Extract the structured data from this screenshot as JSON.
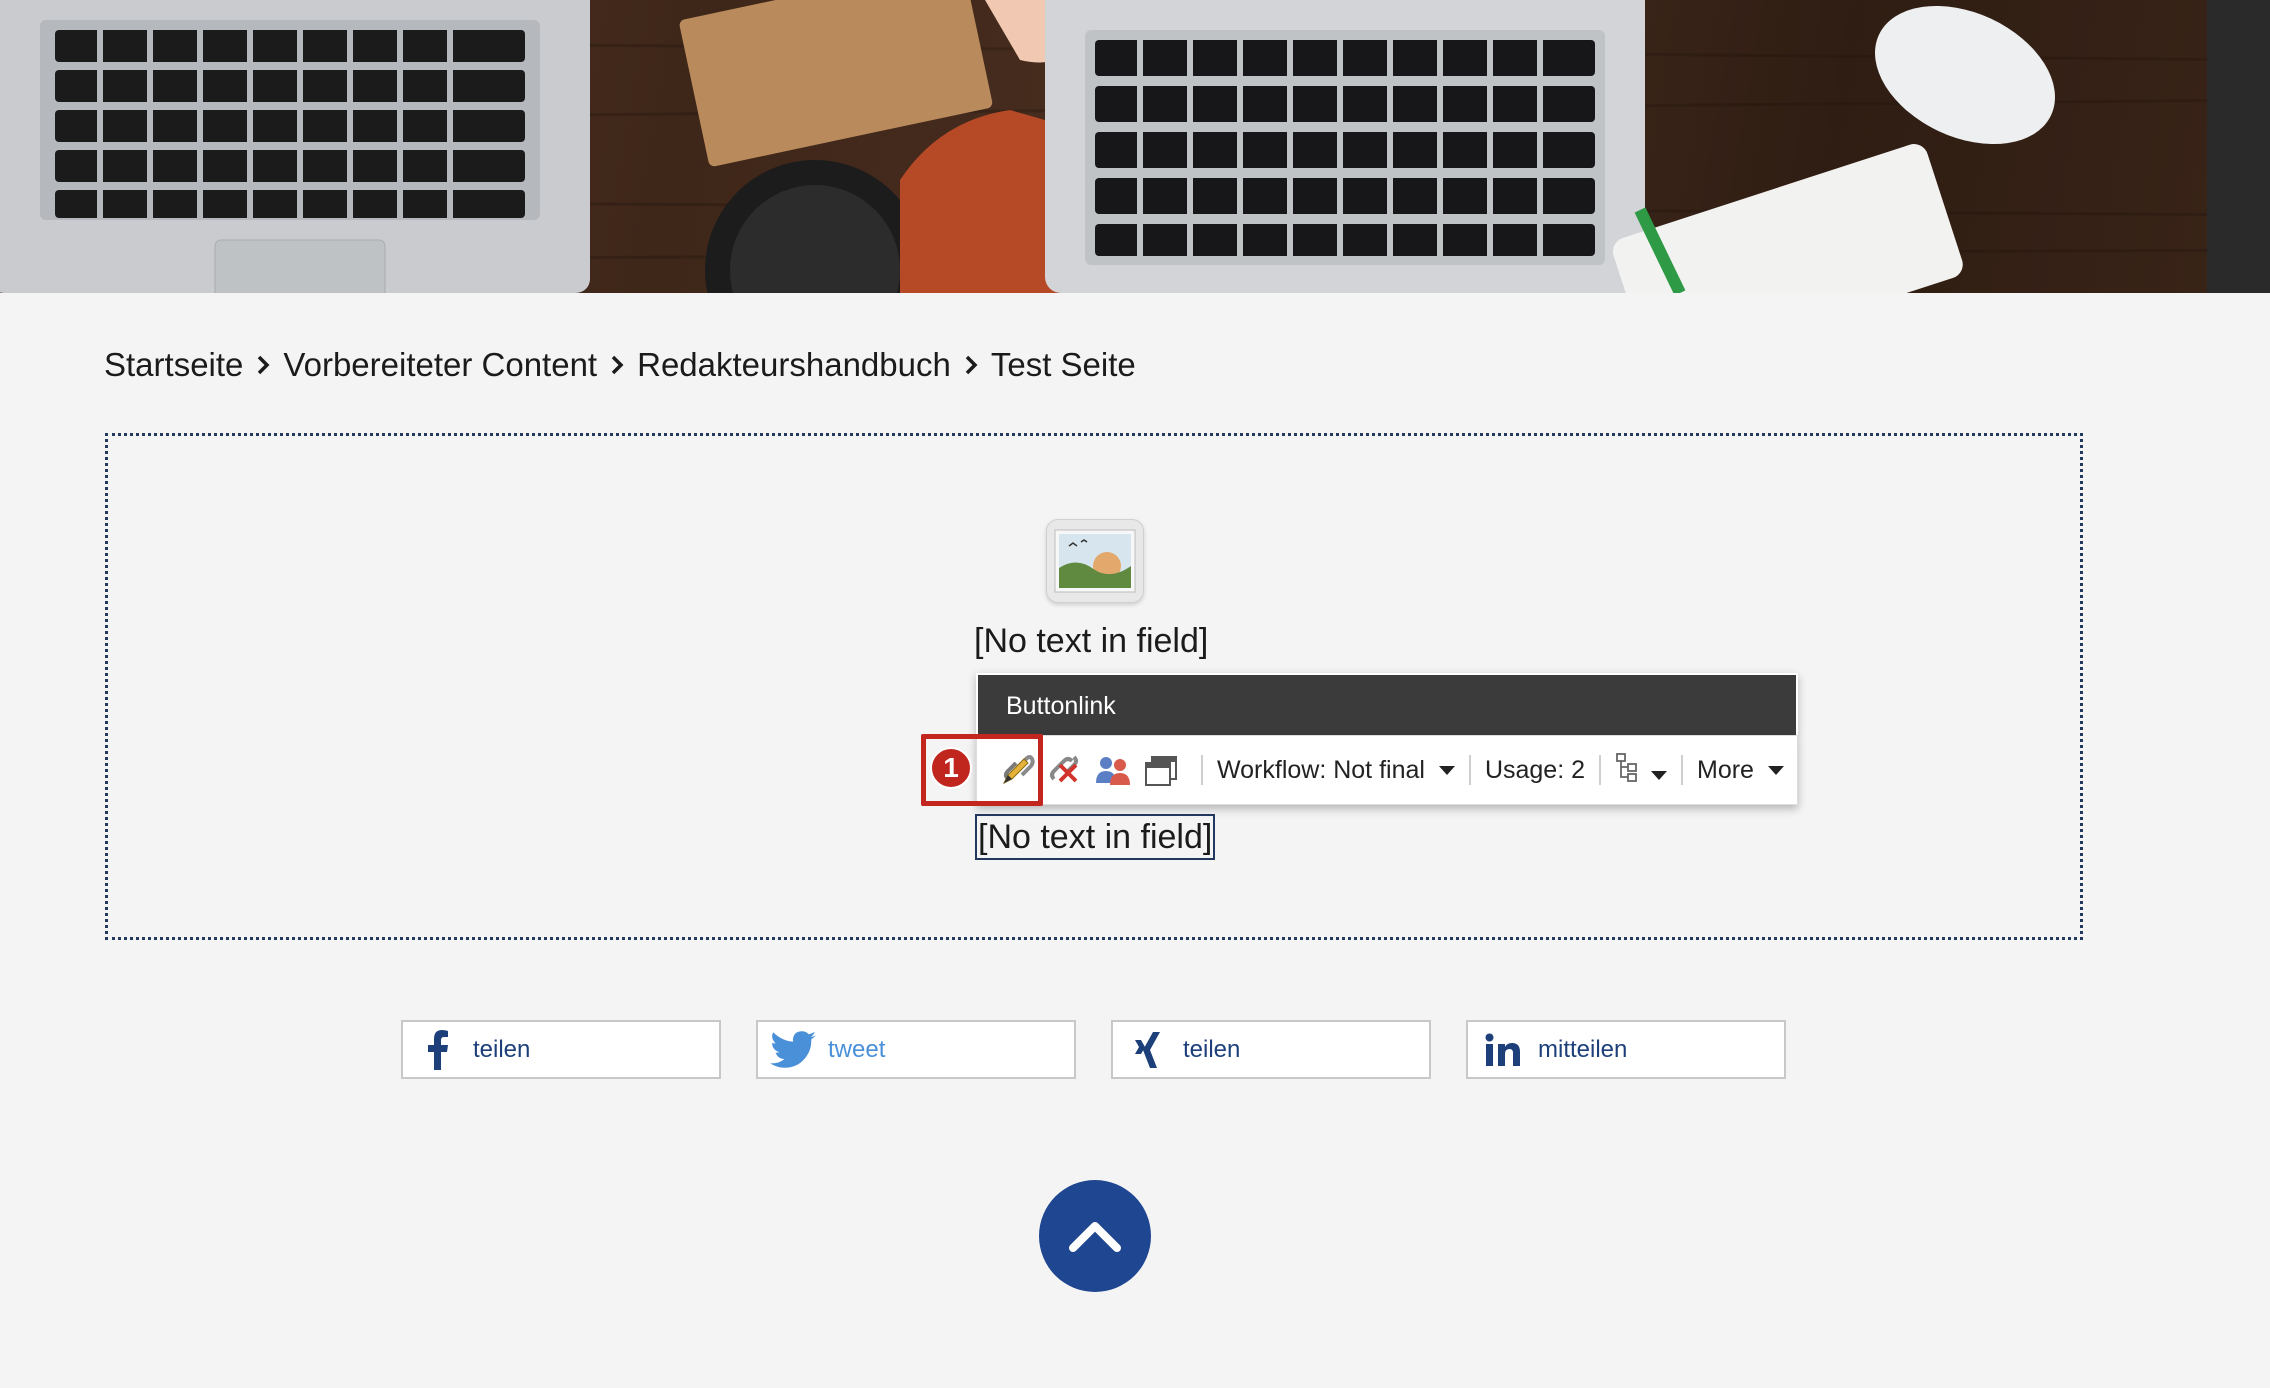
{
  "breadcrumb": {
    "items": [
      "Startseite",
      "Vorbereiteter Content",
      "Redakteurshandbuch",
      "Test Seite"
    ]
  },
  "content": {
    "image_placeholder_icon": "image-placeholder-icon",
    "field_1_text": "[No text in field]",
    "field_2_text": "[No text in field]"
  },
  "toolbar": {
    "title": "Buttonlink",
    "icons": [
      "edit-link-icon",
      "remove-link-icon",
      "personalize-icon",
      "edit-frame-icon"
    ],
    "workflow_label": "Workflow: Not final",
    "usage_label": "Usage: 2",
    "tree_icon": "content-tree-icon",
    "more_label": "More"
  },
  "annotation": {
    "badge_number": "1",
    "color": "#c2261f"
  },
  "share": {
    "facebook_label": "teilen",
    "twitter_label": "tweet",
    "xing_label": "teilen",
    "linkedin_label": "mitteilen"
  },
  "colors": {
    "brand_blue": "#1f4690",
    "toolbar_header": "#3b3b3b",
    "twitter": "#4a90d9"
  }
}
